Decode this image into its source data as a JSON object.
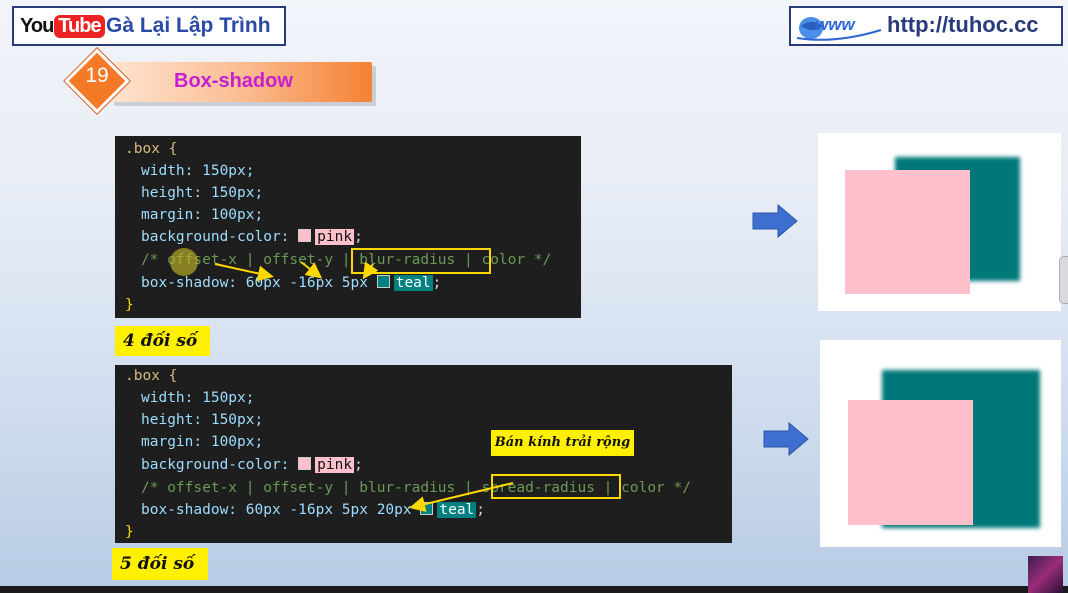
{
  "header": {
    "youtube_you": "You",
    "youtube_tube": "Tube",
    "channel_name": "Gà Lại Lập Trình",
    "url": "http://tuhoc.cc"
  },
  "lesson": {
    "number": "19",
    "title": "Box-shadow"
  },
  "code1": {
    "lines": [
      ".box {",
      "width: 150px;",
      "height: 150px;",
      "margin: 100px;",
      "background-color:",
      "pink",
      "/* offset-x | offset-y | blur-radius | color */",
      "box-shadow: 60px -16px 5px",
      "teal",
      "}"
    ],
    "label": "4 đối số"
  },
  "code2": {
    "lines": [
      ".box {",
      "width: 150px;",
      "height: 150px;",
      "margin: 100px;",
      "background-color:",
      "pink",
      "/* offset-x | offset-y | blur-radius | spread-radius | color */",
      "box-shadow: 60px -16px 5px 20px",
      "teal",
      "}"
    ],
    "label": "5 đối số",
    "annotation": "Bán kính trải rộng"
  },
  "colors": {
    "pink": "#ffc0cb",
    "teal": "#008080",
    "accent_orange": "#f47a28",
    "title_magenta": "#c51fd2",
    "arrow_blue": "#3d6fd0",
    "highlight_yellow": "#ffef00"
  }
}
